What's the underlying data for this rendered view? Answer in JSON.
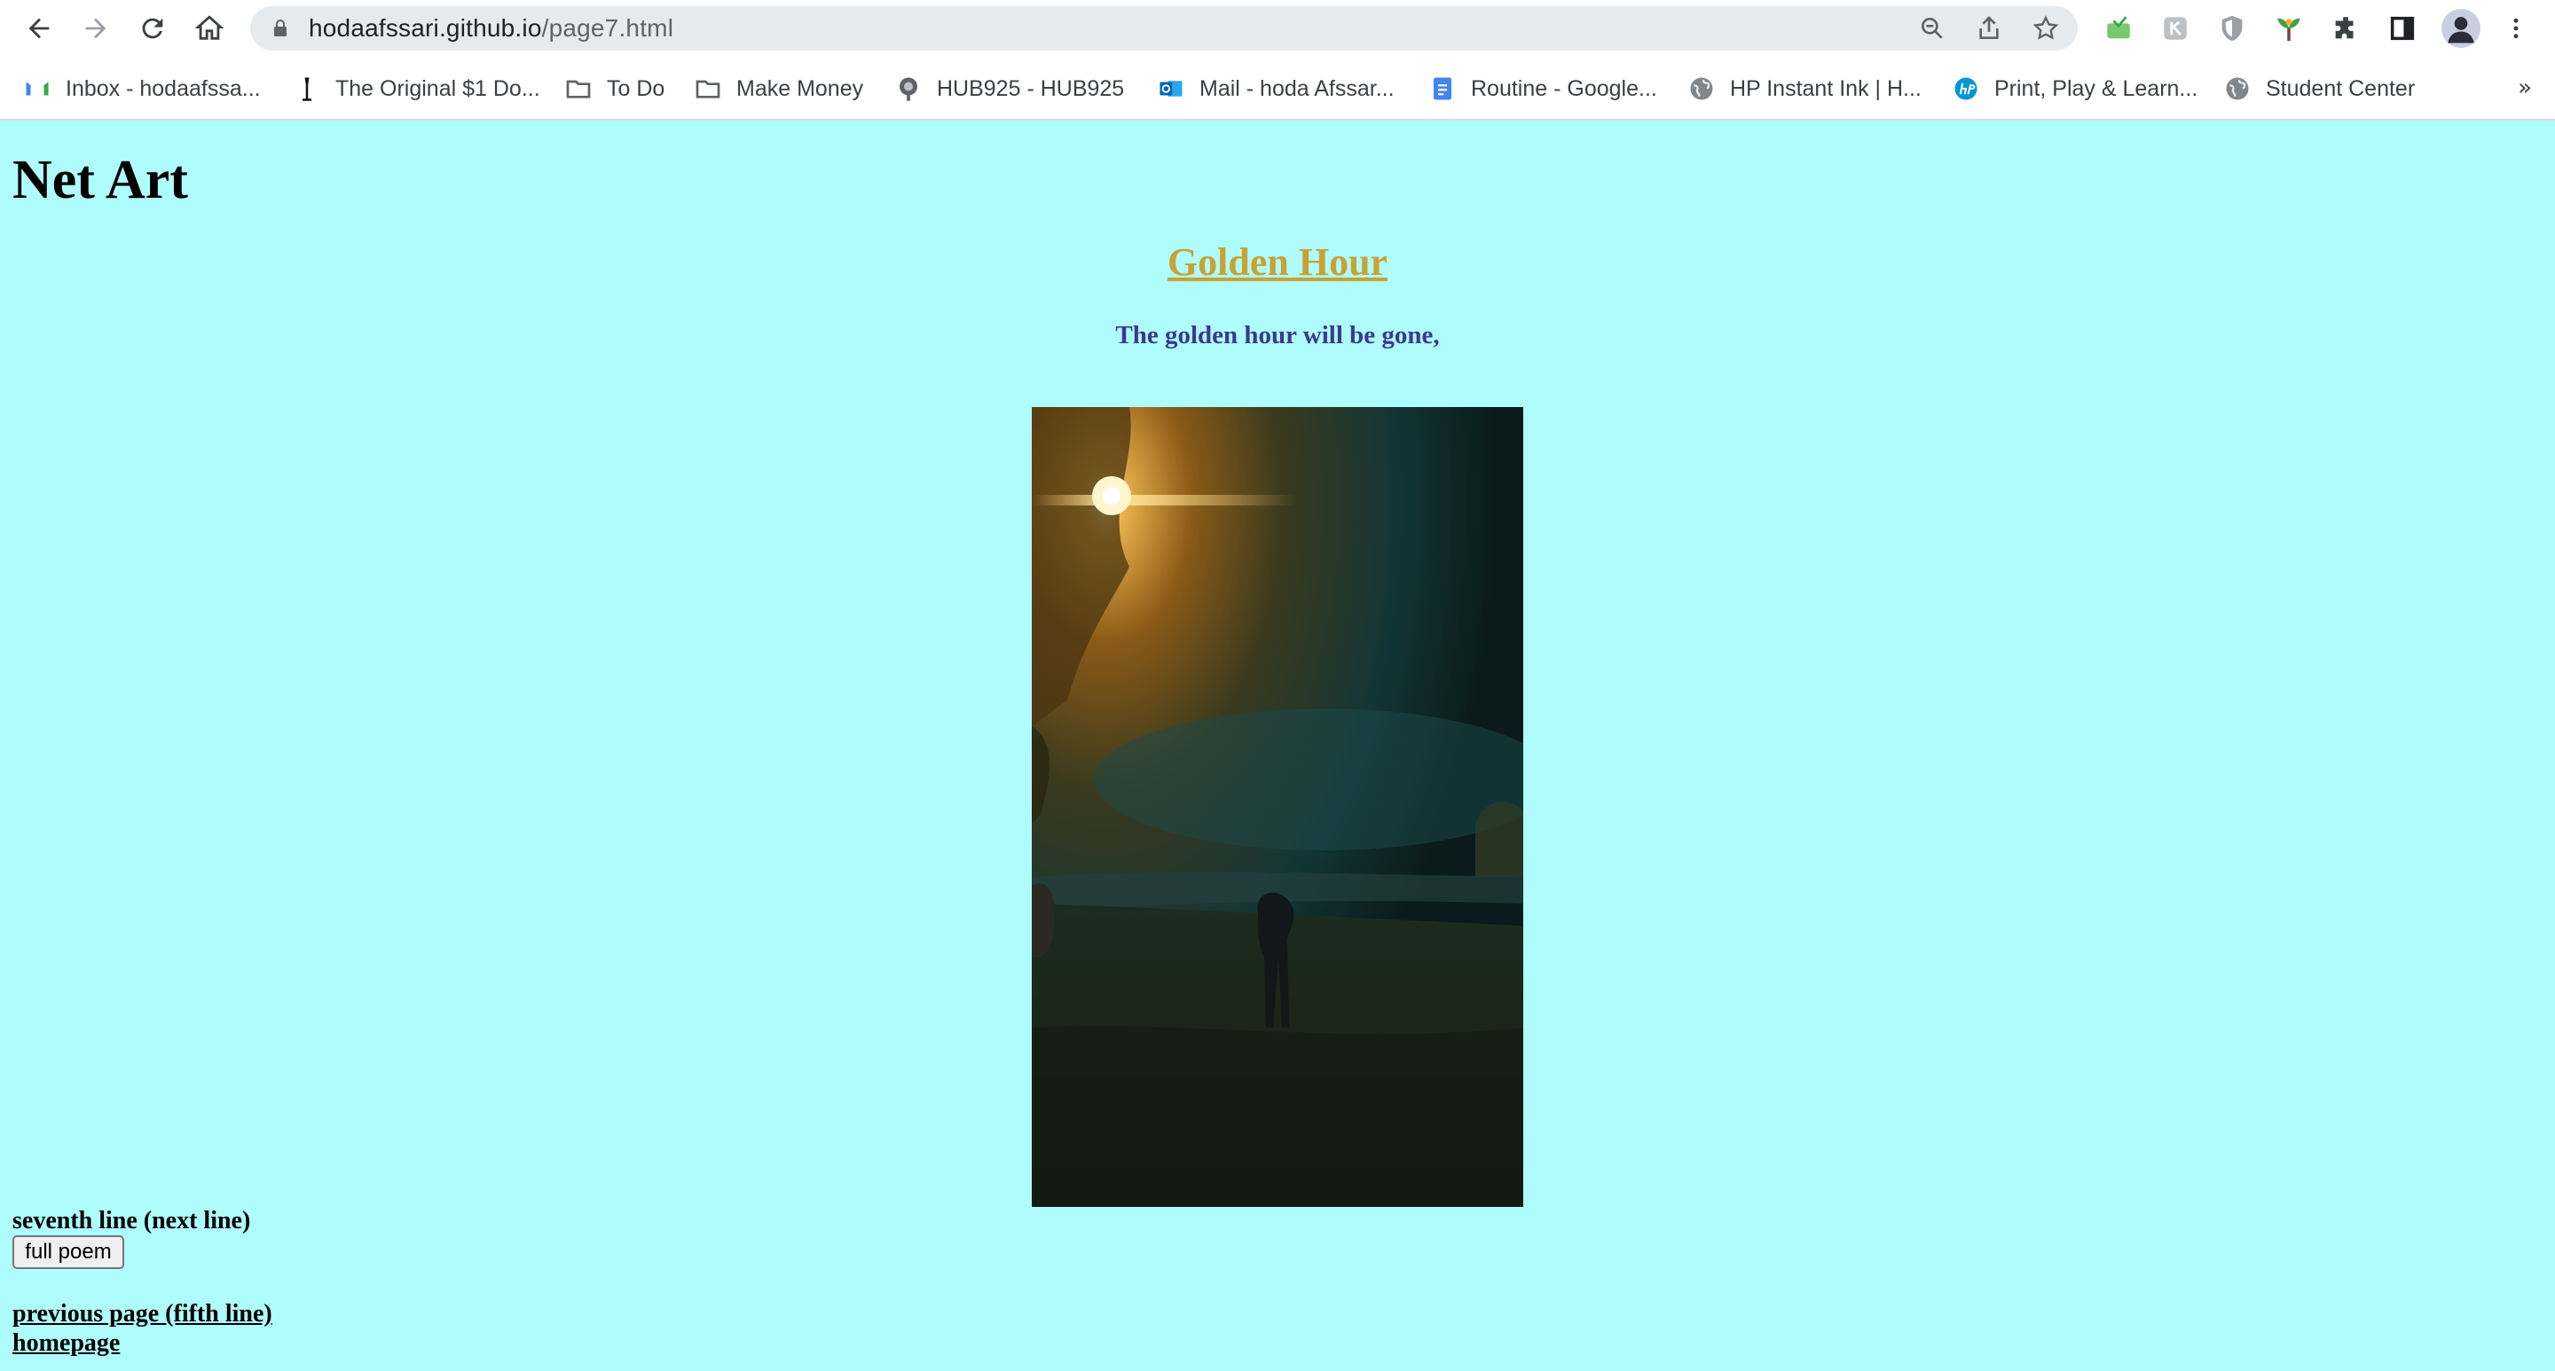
{
  "browser": {
    "url_host": "hodaafssari.github.io",
    "url_path": "/page7.html",
    "bookmarks": [
      {
        "label": "Inbox - hodaafssa...",
        "icon": "gmail-icon"
      },
      {
        "label": "The Original $1 Do...",
        "icon": "razor-icon"
      },
      {
        "label": "To Do",
        "icon": "folder-icon"
      },
      {
        "label": "Make Money",
        "icon": "folder-icon"
      },
      {
        "label": "HUB925 - HUB925",
        "icon": "hub-icon"
      },
      {
        "label": "Mail - hoda Afssar...",
        "icon": "outlook-icon"
      },
      {
        "label": "Routine - Google...",
        "icon": "docs-icon"
      },
      {
        "label": "HP Instant Ink | H...",
        "icon": "globe-icon"
      },
      {
        "label": "Print, Play & Learn...",
        "icon": "hp-icon"
      },
      {
        "label": "Student Center",
        "icon": "globe-icon"
      }
    ],
    "more": "»"
  },
  "page": {
    "heading": "Net Art",
    "art_title": "Golden Hour",
    "poem_line": "The golden hour will be gone,",
    "next_line_link": "seventh line (next line)",
    "full_poem_button": "full poem",
    "previous_link": "previous page (fifth line)",
    "home_link": "homepage"
  },
  "colors": {
    "background": "#aefcfc",
    "title": "#c9a233",
    "poem_text": "#3b3a8f"
  }
}
